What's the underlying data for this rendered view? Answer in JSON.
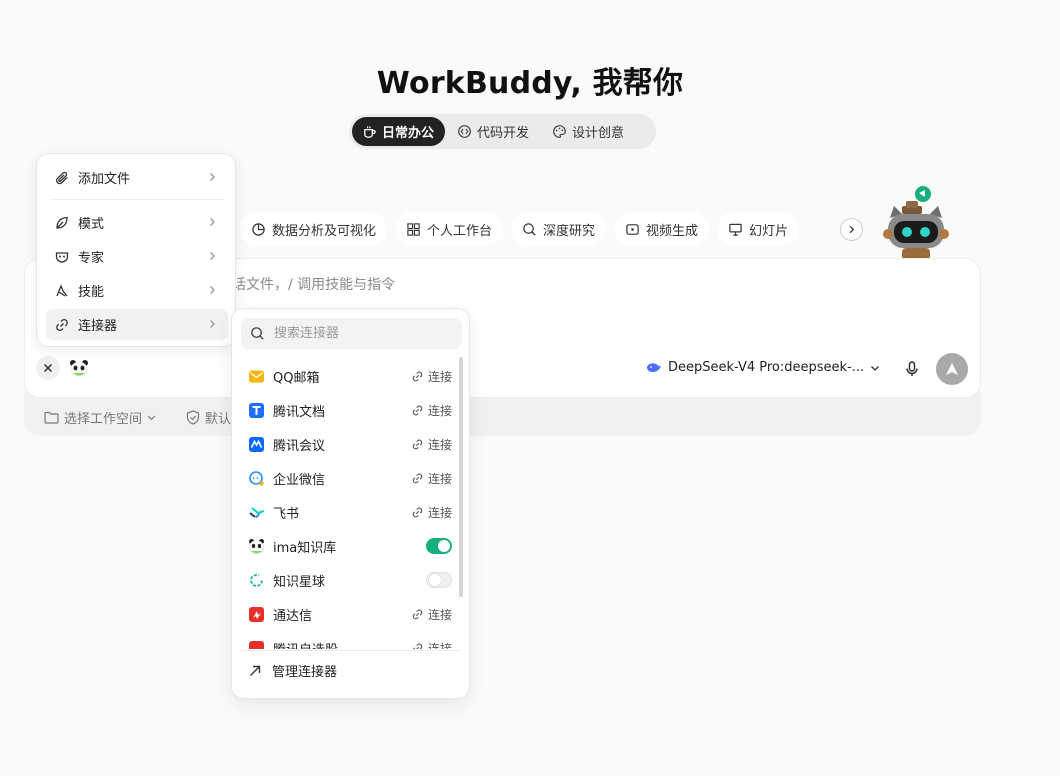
{
  "title": "WorkBuddy, 我帮你",
  "mode_tabs": [
    {
      "label": "日常办公",
      "icon": "coffee-icon",
      "active": true
    },
    {
      "label": "代码开发",
      "icon": "code-icon",
      "active": false
    },
    {
      "label": "设计创意",
      "icon": "palette-icon",
      "active": false
    }
  ],
  "chips": [
    {
      "label": "数据分析及可视化",
      "icon": "pie-chart-icon"
    },
    {
      "label": "个人工作台",
      "icon": "grid-icon"
    },
    {
      "label": "深度研究",
      "icon": "search-icon"
    },
    {
      "label": "视频生成",
      "icon": "video-icon"
    },
    {
      "label": "幻灯片",
      "icon": "slides-icon"
    }
  ],
  "input": {
    "placeholder_visible": "话文件，/ 调用技能与指令"
  },
  "model": {
    "label": "DeepSeek-V4 Pro:deepseek-..."
  },
  "footer": {
    "workspace_label": "选择工作空间",
    "permission_label": "默认"
  },
  "menu": {
    "items": [
      {
        "label": "添加文件",
        "icon": "paperclip-icon"
      },
      {
        "label": "模式",
        "icon": "leaf-icon"
      },
      {
        "label": "专家",
        "icon": "expert-icon"
      },
      {
        "label": "技能",
        "icon": "skill-icon"
      },
      {
        "label": "连接器",
        "icon": "link-icon",
        "active": true
      }
    ]
  },
  "connectors": {
    "search_placeholder": "搜索连接器",
    "connect_label": "连接",
    "items": [
      {
        "name": "QQ邮箱",
        "state": "connect",
        "color": "#f5b400"
      },
      {
        "name": "腾讯文档",
        "state": "connect",
        "color": "#1e6fff"
      },
      {
        "name": "腾讯会议",
        "state": "connect",
        "color": "#0a6cff"
      },
      {
        "name": "企业微信",
        "state": "connect",
        "color": "#2b8cff"
      },
      {
        "name": "飞书",
        "state": "connect",
        "color": "#3370ff"
      },
      {
        "name": "ima知识库",
        "state": "on",
        "color": "#17b07b"
      },
      {
        "name": "知识星球",
        "state": "off",
        "color": "#18b59a"
      },
      {
        "name": "通达信",
        "state": "connect",
        "color": "#e8302a"
      },
      {
        "name": "腾讯自选股",
        "state": "connect",
        "color": "#e8302a"
      }
    ],
    "manage_label": "管理连接器"
  }
}
